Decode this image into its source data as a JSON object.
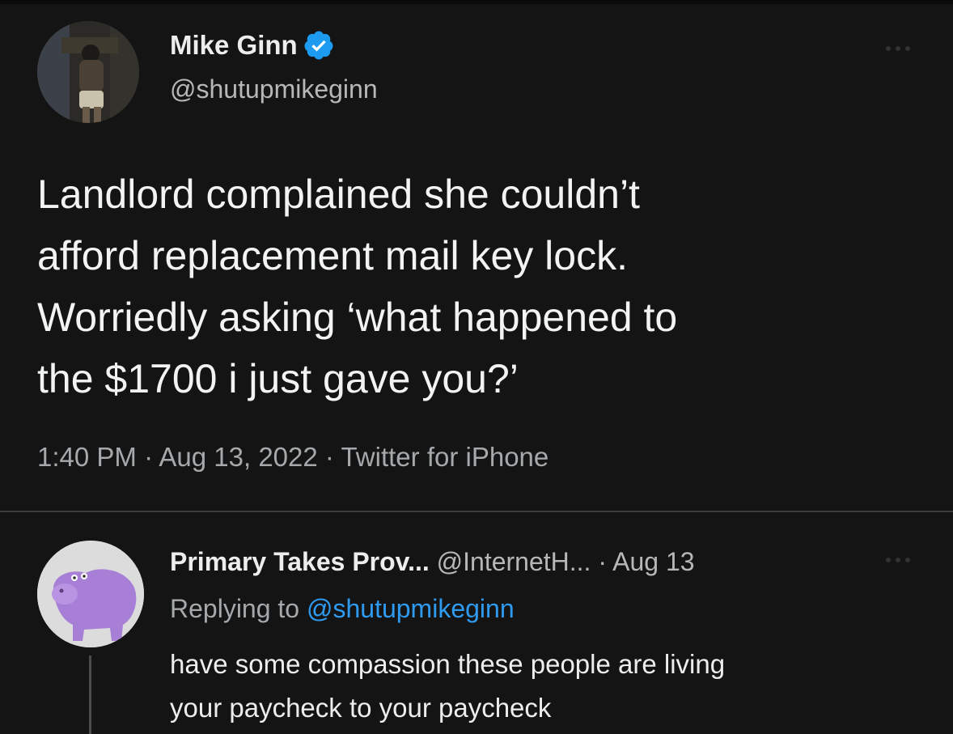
{
  "main_tweet": {
    "author_name": "Mike Ginn",
    "author_handle": "@shutupmikeginn",
    "verified": true,
    "text_lines": [
      "Landlord complained she couldn’t",
      "afford replacement mail key lock.",
      "Worriedly asking ‘what happened to",
      "the $1700 i just gave you?’"
    ],
    "meta": "1:40 PM · Aug 13, 2022 · Twitter for iPhone",
    "more_icon": "more-horizontal-icon"
  },
  "reply": {
    "author_name": "Primary Takes Prov...",
    "author_handle": "@InternetH...",
    "date": "· Aug 13",
    "replying_prefix": "Replying to",
    "replying_handle": "@shutupmikeginn",
    "text_lines": [
      "have some compassion these people are living",
      "your paycheck to your paycheck"
    ],
    "more_icon": "more-horizontal-icon"
  },
  "colors": {
    "background": "#141414",
    "accent_blue": "#1d9bf0",
    "text_primary": "#eceded",
    "text_secondary": "#a6a9ac"
  }
}
